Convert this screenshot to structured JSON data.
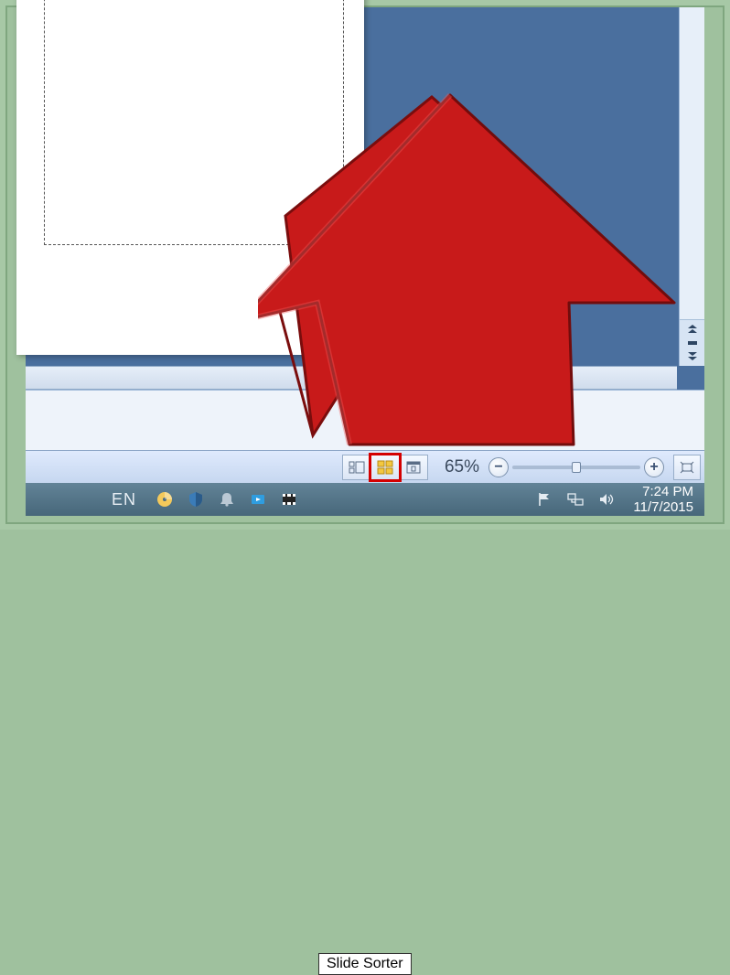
{
  "statusbar": {
    "zoom_level": "65%",
    "view_normal_title": "Normal",
    "view_sorter_title": "Slide Sorter",
    "view_reading_title": "Reading View",
    "zoom_out_label": "−",
    "zoom_in_label": "+",
    "fit_label": "Fit slide to window"
  },
  "tooltip": {
    "text": "Slide Sorter"
  },
  "taskbar": {
    "language": "EN",
    "time": "7:24 PM",
    "date": "11/7/2015"
  },
  "icons": {
    "normal": "normal-view-icon",
    "sorter": "slide-sorter-icon",
    "reading": "reading-view-icon",
    "fit": "fit-icon",
    "minus": "zoom-out-icon",
    "plus": "zoom-in-icon",
    "volume": "volume-icon",
    "network": "network-icon",
    "flag": "flag-icon",
    "bell": "notification-icon",
    "media": "media-icon",
    "film": "film-icon",
    "disc": "disc-icon",
    "shield": "shield-icon"
  }
}
